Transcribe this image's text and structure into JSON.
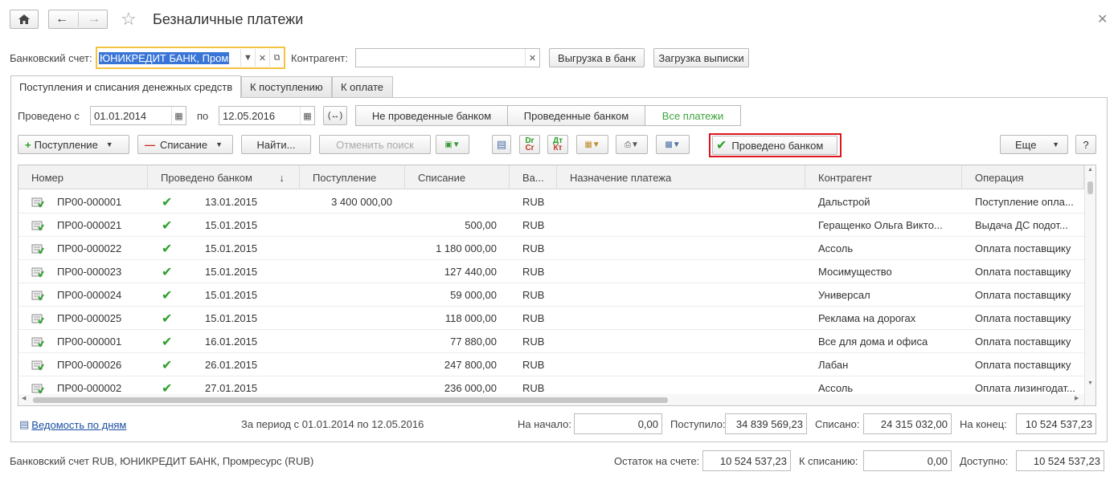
{
  "window": {
    "title": "Безналичные платежи"
  },
  "filters": {
    "bank_account_label": "Банковский счет:",
    "bank_account_value": "ЮНИКРЕДИТ БАНК, Пром",
    "counterparty_label": "Контрагент:",
    "counterparty_value": "",
    "export_button": "Выгрузка в банк",
    "import_button": "Загрузка выписки"
  },
  "tabs": [
    {
      "label": "Поступления и списания денежных средств",
      "active": true
    },
    {
      "label": "К поступлению",
      "active": false
    },
    {
      "label": "К оплате",
      "active": false
    }
  ],
  "period": {
    "from_label": "Проведено с",
    "from_value": "01.01.2014",
    "to_label": "по",
    "to_value": "12.05.2016",
    "segments": [
      "Не проведенные банком",
      "Проведенные банком",
      "Все платежи"
    ]
  },
  "toolbar": {
    "receipt_button": "Поступление",
    "writeoff_button": "Списание",
    "find_button": "Найти...",
    "cancel_search_button": "Отменить поиск",
    "posted_by_bank_button": "Проведено банком",
    "more_button": "Еще",
    "help_button": "?",
    "dtkt_label": "Дт\nКт",
    "drcr_label": "Dr\nCr"
  },
  "table": {
    "columns": [
      "Номер",
      "Проведено банком",
      "↓",
      "Поступление",
      "Списание",
      "Ва...",
      "Назначение платежа",
      "Контрагент",
      "Операция"
    ],
    "rows": [
      {
        "number": "ПР00-000001",
        "date": "13.01.2015",
        "receipt": "3 400 000,00",
        "writeoff": "",
        "currency": "RUB",
        "purpose": "",
        "counterparty": "Дальстрой",
        "operation": "Поступление опла..."
      },
      {
        "number": "ПР00-000021",
        "date": "15.01.2015",
        "receipt": "",
        "writeoff": "500,00",
        "currency": "RUB",
        "purpose": "",
        "counterparty": "Геращенко Ольга Викто...",
        "operation": "Выдача ДС подот..."
      },
      {
        "number": "ПР00-000022",
        "date": "15.01.2015",
        "receipt": "",
        "writeoff": "1 180 000,00",
        "currency": "RUB",
        "purpose": "",
        "counterparty": "Ассоль",
        "operation": "Оплата поставщику"
      },
      {
        "number": "ПР00-000023",
        "date": "15.01.2015",
        "receipt": "",
        "writeoff": "127 440,00",
        "currency": "RUB",
        "purpose": "",
        "counterparty": "Мосимущество",
        "operation": "Оплата поставщику"
      },
      {
        "number": "ПР00-000024",
        "date": "15.01.2015",
        "receipt": "",
        "writeoff": "59 000,00",
        "currency": "RUB",
        "purpose": "",
        "counterparty": "Универсал",
        "operation": "Оплата поставщику"
      },
      {
        "number": "ПР00-000025",
        "date": "15.01.2015",
        "receipt": "",
        "writeoff": "118 000,00",
        "currency": "RUB",
        "purpose": "",
        "counterparty": "Реклама на дорогах",
        "operation": "Оплата поставщику"
      },
      {
        "number": "ПР00-000001",
        "date": "16.01.2015",
        "receipt": "",
        "writeoff": "77 880,00",
        "currency": "RUB",
        "purpose": "",
        "counterparty": "Все для дома и офиса",
        "operation": "Оплата поставщику"
      },
      {
        "number": "ПР00-000026",
        "date": "26.01.2015",
        "receipt": "",
        "writeoff": "247 800,00",
        "currency": "RUB",
        "purpose": "",
        "counterparty": "Лабан",
        "operation": "Оплата поставщику"
      },
      {
        "number": "ПР00-000002",
        "date": "27.01.2015",
        "receipt": "",
        "writeoff": "236 000,00",
        "currency": "RUB",
        "purpose": "",
        "counterparty": "Ассоль",
        "operation": "Оплата лизингодат..."
      }
    ]
  },
  "summary": {
    "report_link": "Ведомость по дням",
    "period_text": "За период с 01.01.2014 по 12.05.2016",
    "start_label": "На начало:",
    "start_value": "0,00",
    "received_label": "Поступило:",
    "received_value": "34 839 569,23",
    "written_off_label": "Списано:",
    "written_off_value": "24 315 032,00",
    "end_label": "На конец:",
    "end_value": "10 524 537,23"
  },
  "footer": {
    "account_text": "Банковский счет RUB, ЮНИКРЕДИТ БАНК, Промресурс (RUB)",
    "balance_label": "Остаток на счете:",
    "balance_value": "10 524 537,23",
    "to_write_off_label": "К списанию:",
    "to_write_off_value": "0,00",
    "available_label": "Доступно:",
    "available_value": "10 524 537,23"
  },
  "colors": {
    "accent_green": "#2aa02a",
    "highlight_red": "#e0141e",
    "focus_yellow": "#f5c342",
    "selection_blue": "#3875d7"
  }
}
